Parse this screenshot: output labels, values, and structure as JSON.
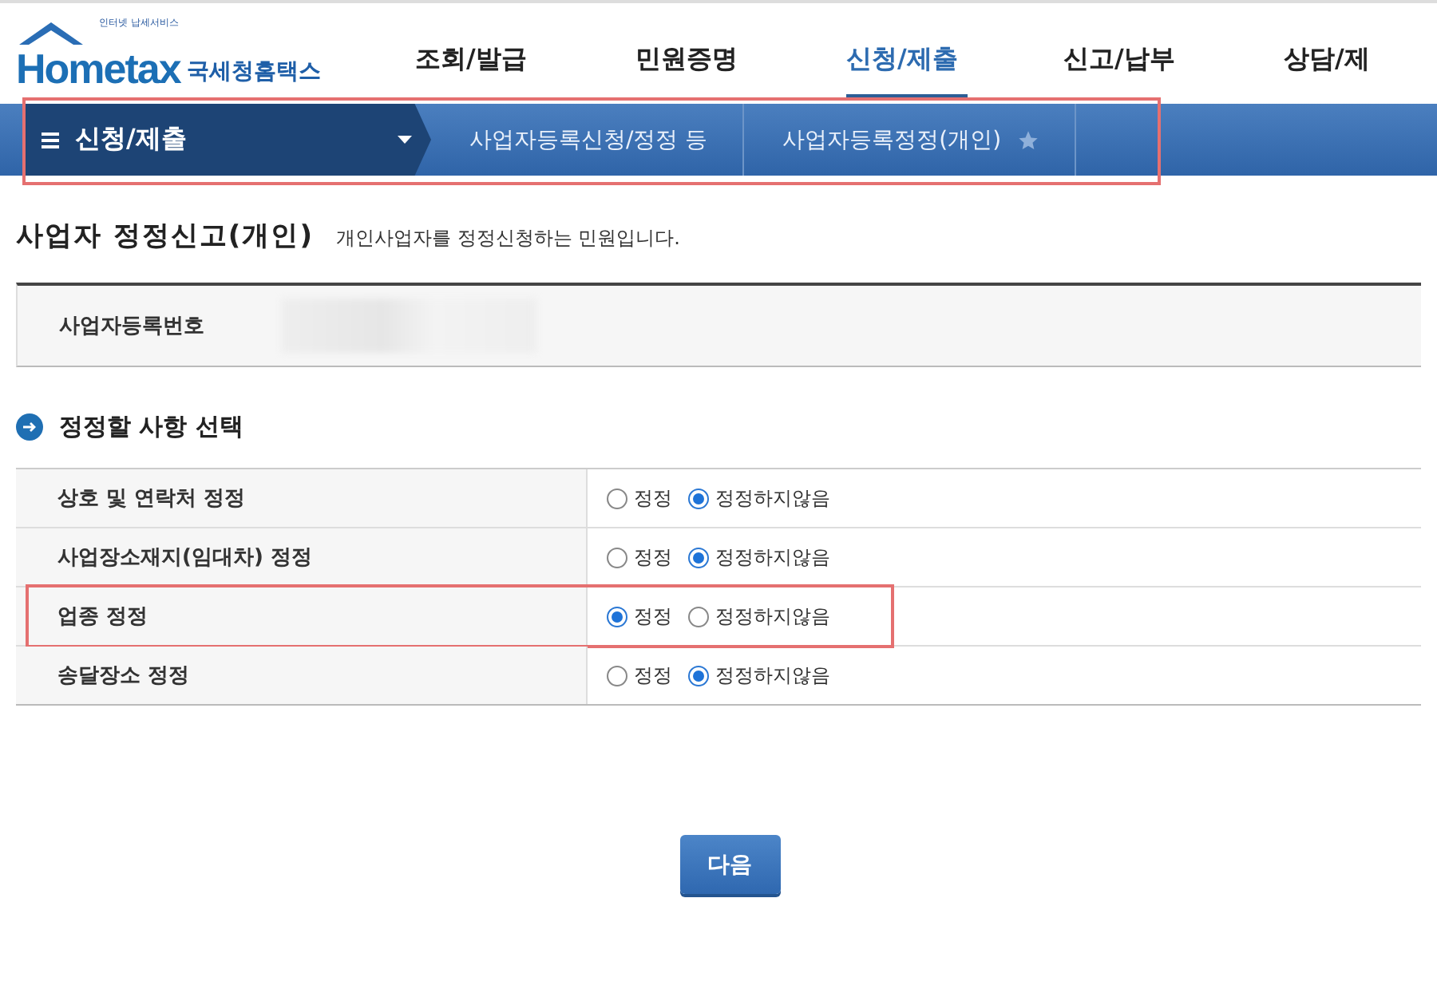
{
  "logo": {
    "tagline": "인터넷 납세서비스",
    "wordmark": "Hometax",
    "name": "국세청홈택스"
  },
  "nav": [
    {
      "label": "조회/발급",
      "selected": false
    },
    {
      "label": "민원증명",
      "selected": false
    },
    {
      "label": "신청/제출",
      "selected": true
    },
    {
      "label": "신고/납부",
      "selected": false
    },
    {
      "label": "상담/제",
      "selected": false
    }
  ],
  "breadcrumb": {
    "menu": "신청/제출",
    "highlighted": true,
    "items": [
      {
        "label": "사업자등록신청/정정 등",
        "favorite": false
      },
      {
        "label": "사업자등록정정(개인)",
        "favorite": true
      }
    ]
  },
  "page": {
    "title": "사업자 정정신고(개인)",
    "description": "개인사업자를 정정신청하는 민원입니다."
  },
  "info": {
    "label": "사업자등록번호",
    "value_redacted": true
  },
  "section": {
    "title": "정정할 사항 선택"
  },
  "options": [
    {
      "label": "상호 및 연락처 정정",
      "highlighted": false,
      "choices": [
        {
          "label": "정정",
          "selected": false
        },
        {
          "label": "정정하지않음",
          "selected": true
        }
      ]
    },
    {
      "label": "사업장소재지(임대차) 정정",
      "highlighted": false,
      "choices": [
        {
          "label": "정정",
          "selected": false
        },
        {
          "label": "정정하지않음",
          "selected": true
        }
      ]
    },
    {
      "label": "업종 정정",
      "highlighted": true,
      "choices": [
        {
          "label": "정정",
          "selected": true
        },
        {
          "label": "정정하지않음",
          "selected": false
        }
      ]
    },
    {
      "label": "송달장소 정정",
      "highlighted": false,
      "choices": [
        {
          "label": "정정",
          "selected": false
        },
        {
          "label": "정정하지않음",
          "selected": true
        }
      ]
    }
  ],
  "buttons": [
    {
      "label": "다음"
    }
  ]
}
